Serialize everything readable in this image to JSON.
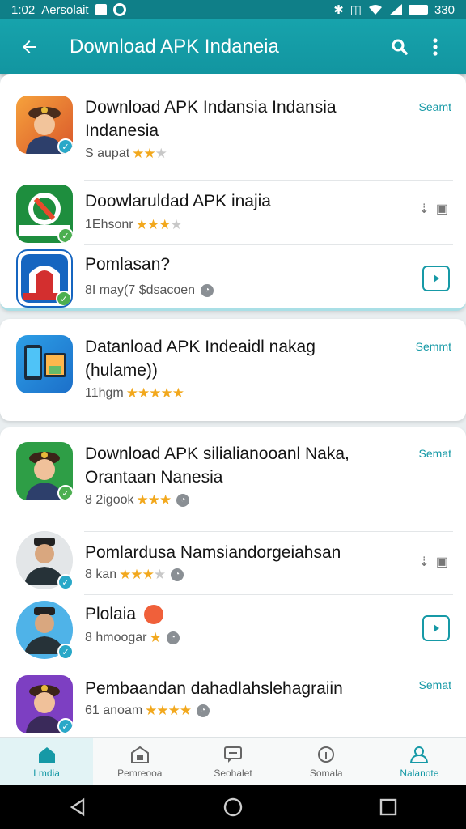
{
  "status_bar": {
    "time": "1:02",
    "carrier": "Aersolait",
    "battery": "330"
  },
  "app_bar": {
    "title": "Download APK Indaneia",
    "back_icon": "arrow-left-icon",
    "search_icon": "search-icon",
    "menu_icon": "more-vert-icon"
  },
  "list": [
    {
      "title": "Download APK Indansia Indansia Indanesia",
      "meta": "S aupat",
      "rating": 2,
      "action": "Seamt",
      "action_type": "text"
    },
    {
      "title": "Doowlaruldad APK inajia",
      "meta": "1Ehsonr",
      "rating": 3,
      "action_type": "icons"
    },
    {
      "title": "Pomlasan?",
      "meta": "8I may(7 $dsacoen",
      "rating": 0,
      "action_type": "open"
    },
    {
      "title": "Datanload APK Indeaidl nakag (hulame))",
      "meta": "11hgm",
      "rating": 5,
      "action": "Semmt",
      "action_type": "text"
    },
    {
      "title": "Download APK silialianooanl Naka, Orantaan Nanesia",
      "meta": "8 2igook",
      "rating": 3,
      "action": "Semat",
      "action_type": "text"
    },
    {
      "title": "Pomlardusa Namsiandorgeiahsan",
      "meta": "8 kan",
      "rating": 3,
      "action_type": "icons"
    },
    {
      "title": "Plolaia",
      "meta": "8 hmoogar",
      "rating": 1,
      "action_type": "open"
    },
    {
      "title": "Pembaandan dahadlahslehagraiin",
      "meta": "61 anoam",
      "rating": 4,
      "action": "Semat",
      "action_type": "text"
    }
  ],
  "bottom_nav": [
    {
      "label": "Lmdia",
      "icon": "home-icon",
      "active": true
    },
    {
      "label": "Pemreooa",
      "icon": "store-icon",
      "active": false
    },
    {
      "label": "Seohalet",
      "icon": "chat-icon",
      "active": false
    },
    {
      "label": "Somala",
      "icon": "info-icon",
      "active": false
    },
    {
      "label": "Nalanote",
      "icon": "profile-icon",
      "active": true
    }
  ],
  "colors": {
    "accent": "#1699a6",
    "app_bar": "#17a3ac",
    "star": "#f2a81d"
  }
}
